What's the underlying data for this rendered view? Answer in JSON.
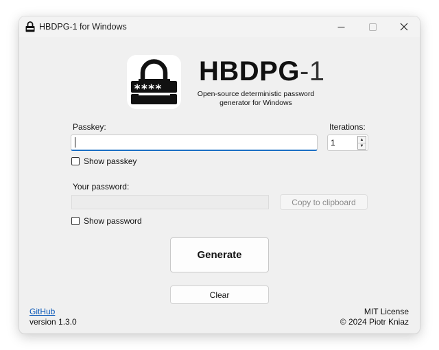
{
  "window": {
    "title": "HBDPG-1 for Windows",
    "controls": {
      "minimize": "—",
      "maximize": "☐",
      "close": "✕"
    }
  },
  "header": {
    "app_name_bold": "HBDPG",
    "app_name_suffix": "-1",
    "subtitle": "Open-source deterministic password generator for Windows",
    "logo_icon": "padlock-icon",
    "logo_mask": "****_"
  },
  "form": {
    "passkey_label": "Passkey:",
    "passkey_value": "",
    "iterations_label": "Iterations:",
    "iterations_value": "1",
    "show_passkey_label": "Show passkey",
    "your_password_label": "Your password:",
    "password_value": "",
    "copy_button_label": "Copy to clipboard",
    "show_password_label": "Show password"
  },
  "actions": {
    "generate_label": "Generate",
    "clear_label": "Clear"
  },
  "footer": {
    "github_label": "GitHub",
    "version": "version 1.3.0",
    "license": "MIT License",
    "copyright": "© 2024 Piotr Kniaz"
  },
  "colors": {
    "accent": "#1a6fc4",
    "link": "#0a58b8",
    "window_bg": "#f0f0f0"
  }
}
